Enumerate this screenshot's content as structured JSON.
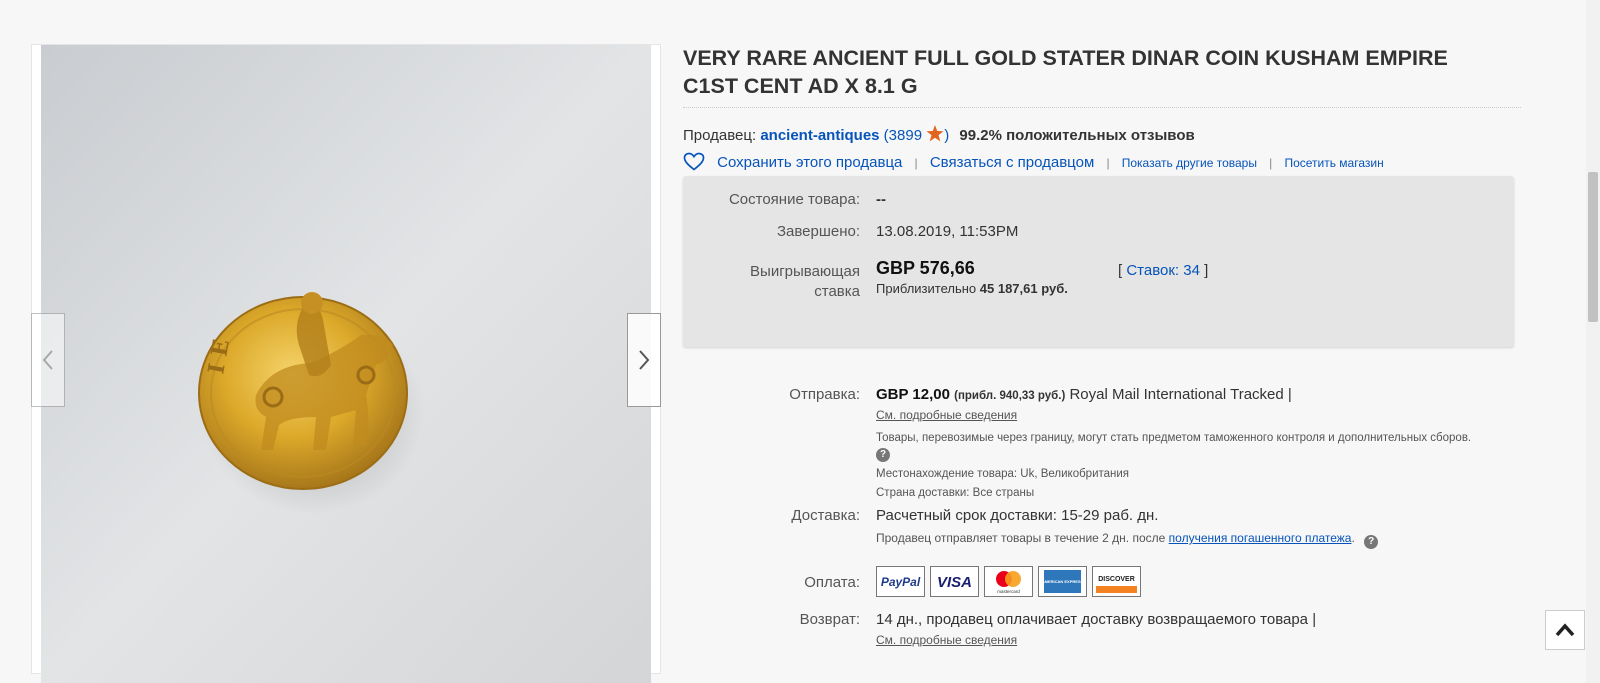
{
  "listing": {
    "title": "VERY RARE ANCIENT FULL GOLD STATER DINAR COIN KUSHAM EMPIRE C1ST CENT AD X 8.1 G"
  },
  "seller": {
    "label": "Продавец:",
    "name": "ancient-antiques",
    "open_paren": "(",
    "feedback_count": "3899",
    "close_paren": ")",
    "positive_feedback": "99.2% положительных отзывов",
    "save_seller": "Сохранить этого продавца",
    "contact_seller": "Связаться с продавцом",
    "other_items": "Показать другие товары",
    "visit_store": "Посетить магазин",
    "sep": "|"
  },
  "status": {
    "condition_label": "Состояние товара:",
    "condition_value": "--",
    "ended_label": "Завершено:",
    "ended_value": "13.08.2019, 11:53PM",
    "winning_bid_label_1": "Выигрывающая",
    "winning_bid_label_2": "ставка",
    "winning_bid_value": "GBP 576,66",
    "approx_label": "Приблизительно",
    "approx_value": "45 187,61 руб.",
    "bids_open": "[",
    "bids_link": "Ставок: 34",
    "bids_close": "]"
  },
  "shipping": {
    "label": "Отправка:",
    "price": "GBP 12,00",
    "approx": "(прибл. 940,33 руб.)",
    "service": "Royal Mail International Tracked |",
    "details_link": "См. подробные сведения",
    "customs_note": "Товары, перевозимые через границу, могут стать предметом таможенного контроля и дополнительных сборов.",
    "location": "Местонахождение товара:  Uk, Великобритания",
    "ships_to": "Страна доставки:  Все страны"
  },
  "delivery": {
    "label": "Доставка:",
    "estimate": "Расчетный срок доставки: 15-29 раб. дн.",
    "handling_prefix": "Продавец отправляет товары в течение 2 дн. после",
    "handling_link": "получения погашенного платежа",
    "handling_suffix": "."
  },
  "payment": {
    "label": "Оплата:",
    "methods": [
      "PayPal",
      "VISA",
      "mastercard",
      "AMERICAN EXPRESS",
      "DISCOVER"
    ]
  },
  "returns": {
    "label": "Возврат:",
    "policy": "14 дн., продавец оплачивает доставку возвращаемого товара |",
    "details_link": "См. подробные сведения"
  },
  "icons": {
    "star": "star-icon",
    "heart": "heart-icon",
    "help": "help-icon",
    "help_glyph": "?",
    "chevron_left": "chevron-left-icon",
    "chevron_right": "chevron-right-icon",
    "chevron_up": "chevron-up-icon"
  },
  "colors": {
    "link": "#0654ba",
    "star": "#e0651e",
    "info_box": "#e5e5e5",
    "coin_gold": "#d7a322"
  }
}
